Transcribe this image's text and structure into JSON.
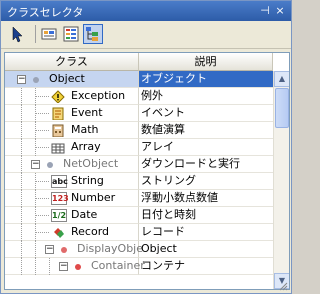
{
  "window": {
    "title": "クラスセレクタ",
    "pin_glyph": "⊣",
    "close_glyph": "×"
  },
  "toolbar": {
    "tools": [
      {
        "icon": "pointer-arrow-icon",
        "active": false
      },
      {
        "icon": "category-view-icon",
        "active": false
      },
      {
        "icon": "list-view-icon",
        "active": false
      },
      {
        "icon": "tree-view-icon",
        "active": true
      }
    ]
  },
  "table": {
    "headers": {
      "class": "クラス",
      "description": "説明"
    },
    "rows": [
      {
        "name": "Object",
        "desc": "オブジェクト",
        "icon": "object-icon",
        "selected": true,
        "expander": "minus"
      },
      {
        "name": "Exception",
        "desc": "例外",
        "icon": "exception-icon",
        "selected": false,
        "expander": ""
      },
      {
        "name": "Event",
        "desc": "イベント",
        "icon": "event-icon",
        "selected": false,
        "expander": ""
      },
      {
        "name": "Math",
        "desc": "数値演算",
        "icon": "math-icon",
        "selected": false,
        "expander": ""
      },
      {
        "name": "Array",
        "desc": "アレイ",
        "icon": "array-icon",
        "selected": false,
        "expander": ""
      },
      {
        "name": "NetObject",
        "desc": "ダウンロードと実行",
        "icon": "netobject-icon",
        "selected": false,
        "expander": "minus"
      },
      {
        "name": "String",
        "desc": "ストリング",
        "icon": "string-icon",
        "selected": false,
        "expander": ""
      },
      {
        "name": "Number",
        "desc": "浮動小数点数値",
        "icon": "number-icon",
        "selected": false,
        "expander": ""
      },
      {
        "name": "Date",
        "desc": "日付と時刻",
        "icon": "date-icon",
        "selected": false,
        "expander": ""
      },
      {
        "name": "Record",
        "desc": "レコード",
        "icon": "record-icon",
        "selected": false,
        "expander": ""
      },
      {
        "name": "DisplayObje",
        "desc": "Object",
        "icon": "displayobject-icon",
        "selected": false,
        "expander": "minus"
      },
      {
        "name": "Container",
        "desc": "コンテナ",
        "icon": "container-icon",
        "selected": false,
        "expander": "minus"
      }
    ],
    "icon_labels": {
      "string": "abc",
      "number": "123",
      "date": "1/2"
    }
  },
  "scrollbar": {
    "up_glyph": "▲",
    "down_glyph": "▼"
  }
}
